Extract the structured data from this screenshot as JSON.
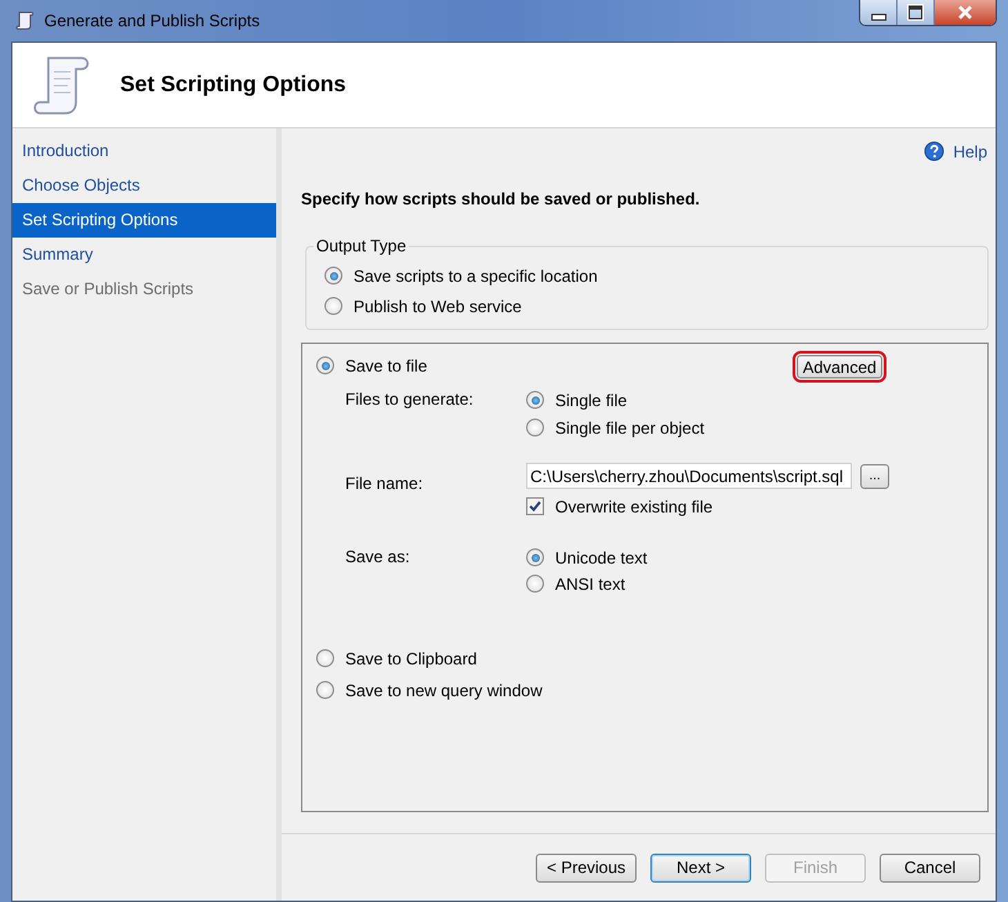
{
  "window": {
    "title": "Generate and Publish Scripts"
  },
  "header": {
    "title": "Set Scripting Options"
  },
  "sidebar": {
    "items": [
      {
        "label": "Introduction",
        "selected": false,
        "disabled": false
      },
      {
        "label": "Choose Objects",
        "selected": false,
        "disabled": false
      },
      {
        "label": "Set Scripting Options",
        "selected": true,
        "disabled": false
      },
      {
        "label": "Summary",
        "selected": false,
        "disabled": false
      },
      {
        "label": "Save or Publish Scripts",
        "selected": false,
        "disabled": true
      }
    ]
  },
  "help": {
    "label": "Help"
  },
  "instruction": "Specify how scripts should be saved or published.",
  "output_type": {
    "legend": "Output Type",
    "options": [
      {
        "label": "Save scripts to a specific location",
        "selected": true
      },
      {
        "label": "Publish to Web service",
        "selected": false
      }
    ]
  },
  "save_to_file": {
    "label": "Save to file",
    "selected": true
  },
  "advanced_button": {
    "label": "Advanced",
    "highlighted": true
  },
  "files_to_generate": {
    "label": "Files to generate:",
    "options": [
      {
        "label": "Single file",
        "selected": true
      },
      {
        "label": "Single file per object",
        "selected": false
      }
    ]
  },
  "file_name": {
    "label": "File name:",
    "value": "C:\\Users\\cherry.zhou\\Documents\\script.sql",
    "browse": "..."
  },
  "overwrite": {
    "label": "Overwrite existing file",
    "checked": true
  },
  "save_as": {
    "label": "Save as:",
    "options": [
      {
        "label": "Unicode text",
        "selected": true
      },
      {
        "label": "ANSI text",
        "selected": false
      }
    ]
  },
  "other_destinations": [
    {
      "label": "Save to Clipboard",
      "selected": false
    },
    {
      "label": "Save to new query window",
      "selected": false
    }
  ],
  "buttons": [
    {
      "label": "< Previous",
      "default": false,
      "disabled": false
    },
    {
      "label": "Next >",
      "default": true,
      "disabled": false
    },
    {
      "label": "Finish",
      "default": false,
      "disabled": true
    },
    {
      "label": "Cancel",
      "default": false,
      "disabled": false
    }
  ]
}
